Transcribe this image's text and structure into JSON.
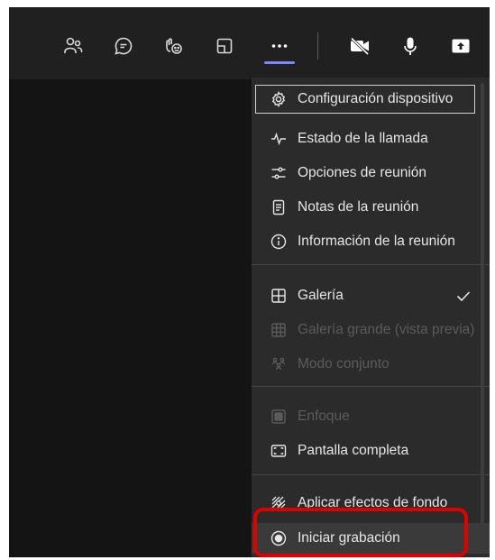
{
  "toolbar": {
    "buttons": [
      {
        "name": "people-icon"
      },
      {
        "name": "chat-icon"
      },
      {
        "name": "reactions-icon"
      },
      {
        "name": "rooms-icon"
      },
      {
        "name": "more-options-icon"
      },
      {
        "name": "camera-off-icon"
      },
      {
        "name": "microphone-icon"
      },
      {
        "name": "share-screen-icon"
      }
    ],
    "accent_color": "#7f85f5"
  },
  "menu": {
    "items": [
      {
        "label": "Configuración dispositivo",
        "icon": "gear-icon"
      },
      {
        "label": "Estado de la llamada",
        "icon": "pulse-icon"
      },
      {
        "label": "Opciones de reunión",
        "icon": "sliders-icon"
      },
      {
        "label": "Notas de la reunión",
        "icon": "notes-icon"
      },
      {
        "label": "Información de la reunión",
        "icon": "info-icon"
      },
      {
        "label": "Galería",
        "icon": "gallery-icon"
      },
      {
        "label": "Galería grande (vista previa)",
        "icon": "large-gallery-icon"
      },
      {
        "label": "Modo conjunto",
        "icon": "together-mode-icon"
      },
      {
        "label": "Enfoque",
        "icon": "focus-icon"
      },
      {
        "label": "Pantalla completa",
        "icon": "fullscreen-icon"
      },
      {
        "label": "Aplicar efectos de fondo",
        "icon": "background-effects-icon"
      },
      {
        "label": "Iniciar grabación",
        "icon": "record-icon"
      }
    ]
  },
  "highlight_color": "#e00000"
}
